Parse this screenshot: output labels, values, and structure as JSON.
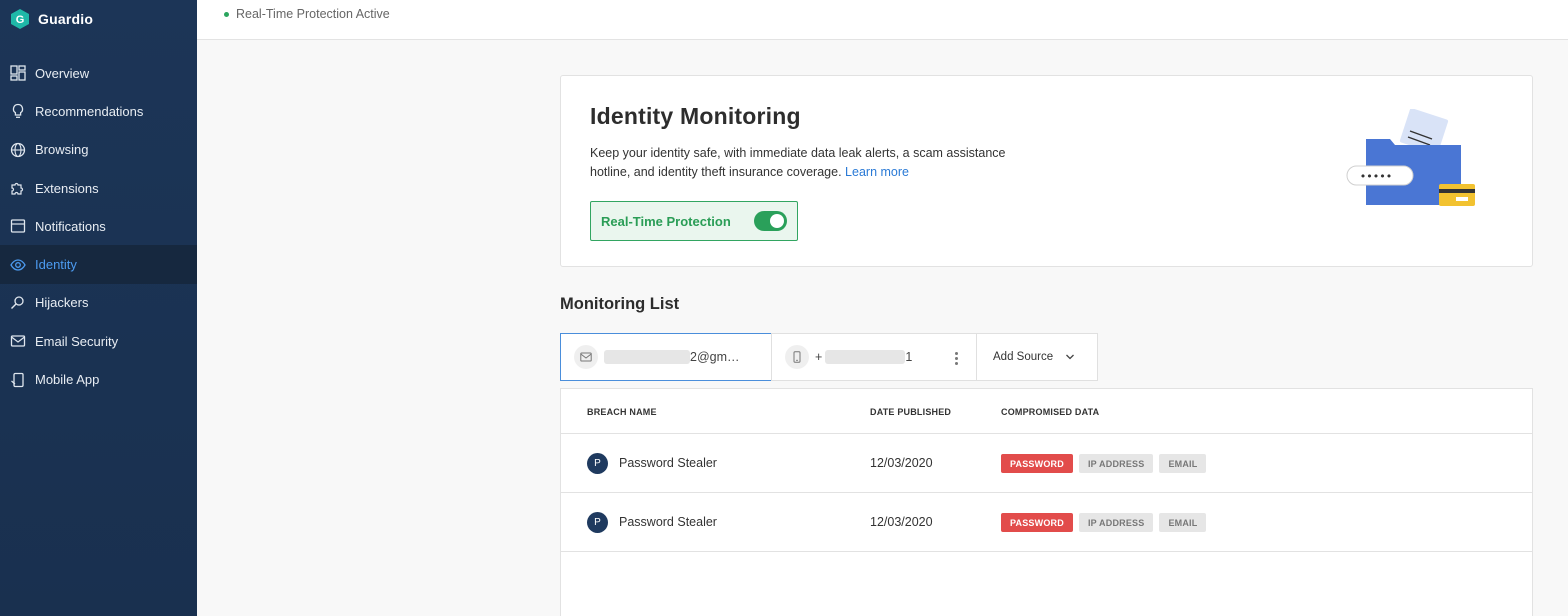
{
  "app": {
    "name": "Guardio"
  },
  "status": {
    "text": "Real-Time Protection Active",
    "color": "#2ba55e"
  },
  "sidebar": {
    "items": [
      {
        "label": "Overview",
        "icon": "dashboard-icon"
      },
      {
        "label": "Recommendations",
        "icon": "lightbulb-icon"
      },
      {
        "label": "Browsing",
        "icon": "globe-icon"
      },
      {
        "label": "Extensions",
        "icon": "puzzle-icon"
      },
      {
        "label": "Notifications",
        "icon": "bell-icon"
      },
      {
        "label": "Identity",
        "icon": "eye-icon",
        "active": true
      },
      {
        "label": "Hijackers",
        "icon": "search-person-icon"
      },
      {
        "label": "Email Security",
        "icon": "mail-icon"
      },
      {
        "label": "Mobile App",
        "icon": "mobile-icon"
      }
    ]
  },
  "identity": {
    "title": "Identity Monitoring",
    "description": "Keep your identity safe, with immediate data leak alerts, a scam assistance hotline, and identity theft insurance coverage.",
    "learn_more": "Learn more",
    "protection_label": "Real-Time Protection",
    "protection_enabled": true,
    "password_dots": "•••••"
  },
  "monitoring": {
    "title": "Monitoring List",
    "sources": {
      "email": {
        "suffix": "2@gm…",
        "icon": "mail-icon",
        "selected": true
      },
      "phone": {
        "prefix": "+",
        "suffix": "1",
        "icon": "phone-icon"
      },
      "add_label": "Add Source"
    },
    "columns": [
      "BREACH NAME",
      "DATE PUBLISHED",
      "COMPROMISED DATA"
    ],
    "rows": [
      {
        "avatar": "P",
        "name": "Password Stealer",
        "date": "12/03/2020",
        "tags": [
          "PASSWORD",
          "IP ADDRESS",
          "EMAIL"
        ]
      },
      {
        "avatar": "P",
        "name": "Password Stealer",
        "date": "12/03/2020",
        "tags": [
          "PASSWORD",
          "IP ADDRESS",
          "EMAIL"
        ]
      }
    ]
  },
  "colors": {
    "accent": "#2a7ad6",
    "success": "#2aa05a",
    "danger": "#e24c4b",
    "sidebar": "#1c3557"
  }
}
